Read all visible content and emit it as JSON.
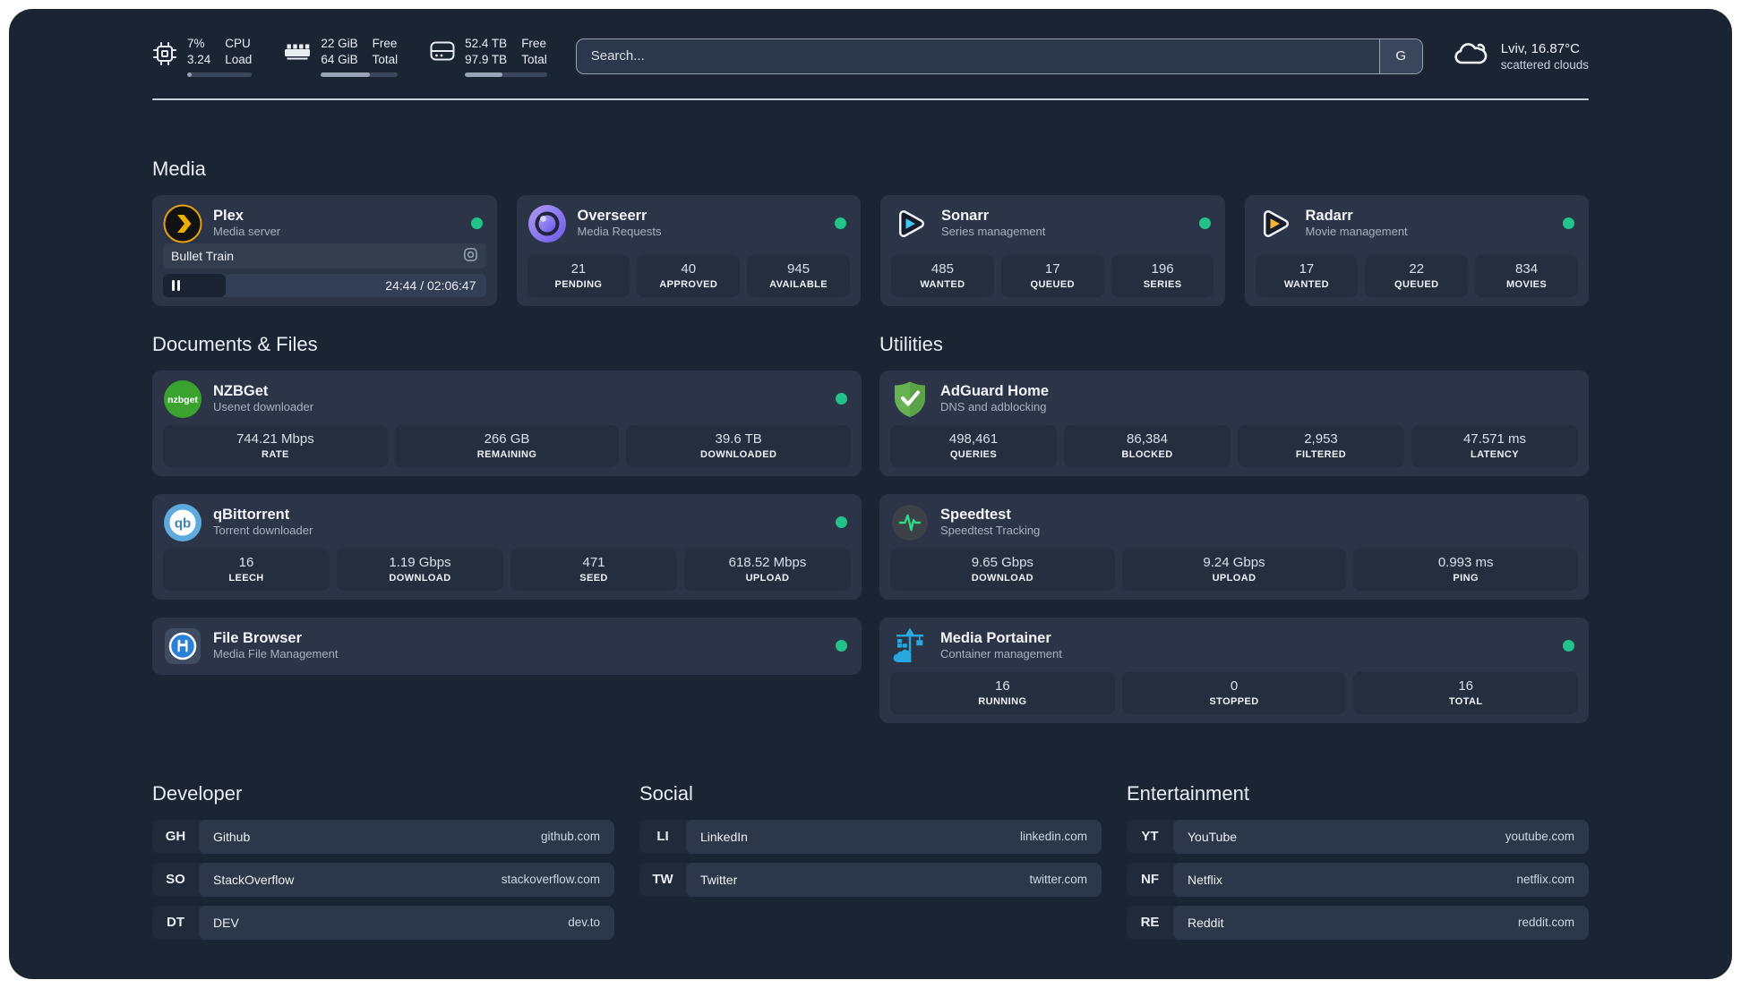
{
  "colors": {
    "accent_green": "#22c38b",
    "background": "#1b2433",
    "card": "#2b3547"
  },
  "header": {
    "monitors": [
      {
        "name": "cpu",
        "value_top": "7%",
        "value_bottom": "3.24",
        "label_top": "CPU",
        "label_bottom": "Load",
        "progress_pct": 7
      },
      {
        "name": "memory",
        "value_top": "22 GiB",
        "value_bottom": "64 GiB",
        "label_top": "Free",
        "label_bottom": "Total",
        "progress_pct": 64
      },
      {
        "name": "storage",
        "value_top": "52.4 TB",
        "value_bottom": "97.9 TB",
        "label_top": "Free",
        "label_bottom": "Total",
        "progress_pct": 46
      }
    ],
    "search": {
      "placeholder": "Search...",
      "engine_button": "G"
    },
    "weather": {
      "location": "Lviv, 16.87°C",
      "condition": "scattered clouds"
    }
  },
  "media": {
    "title": "Media",
    "plex": {
      "name": "Plex",
      "subtitle": "Media server",
      "status": "online",
      "player": {
        "title": "Bullet Train",
        "time": "24:44 / 02:06:47",
        "progress_pct": 19.5
      }
    },
    "overseerr": {
      "name": "Overseerr",
      "subtitle": "Media Requests",
      "status": "online",
      "stats": [
        {
          "value": "21",
          "label": "PENDING"
        },
        {
          "value": "40",
          "label": "APPROVED"
        },
        {
          "value": "945",
          "label": "AVAILABLE"
        }
      ]
    },
    "sonarr": {
      "name": "Sonarr",
      "subtitle": "Series management",
      "status": "online",
      "stats": [
        {
          "value": "485",
          "label": "WANTED"
        },
        {
          "value": "17",
          "label": "QUEUED"
        },
        {
          "value": "196",
          "label": "SERIES"
        }
      ]
    },
    "radarr": {
      "name": "Radarr",
      "subtitle": "Movie management",
      "status": "online",
      "stats": [
        {
          "value": "17",
          "label": "WANTED"
        },
        {
          "value": "22",
          "label": "QUEUED"
        },
        {
          "value": "834",
          "label": "MOVIES"
        }
      ]
    }
  },
  "documents": {
    "title": "Documents & Files",
    "nzbget": {
      "name": "NZBGet",
      "subtitle": "Usenet downloader",
      "status": "online",
      "stats": [
        {
          "value": "744.21 Mbps",
          "label": "RATE"
        },
        {
          "value": "266 GB",
          "label": "REMAINING"
        },
        {
          "value": "39.6 TB",
          "label": "DOWNLOADED"
        }
      ]
    },
    "qbittorrent": {
      "name": "qBittorrent",
      "subtitle": "Torrent downloader",
      "status": "online",
      "stats": [
        {
          "value": "16",
          "label": "LEECH"
        },
        {
          "value": "1.19 Gbps",
          "label": "DOWNLOAD"
        },
        {
          "value": "471",
          "label": "SEED"
        },
        {
          "value": "618.52 Mbps",
          "label": "UPLOAD"
        }
      ]
    },
    "filebrowser": {
      "name": "File Browser",
      "subtitle": "Media File Management",
      "status": "online"
    }
  },
  "utilities": {
    "title": "Utilities",
    "adguard": {
      "name": "AdGuard Home",
      "subtitle": "DNS and adblocking",
      "stats": [
        {
          "value": "498,461",
          "label": "QUERIES"
        },
        {
          "value": "86,384",
          "label": "BLOCKED"
        },
        {
          "value": "2,953",
          "label": "FILTERED"
        },
        {
          "value": "47.571 ms",
          "label": "LATENCY"
        }
      ]
    },
    "speedtest": {
      "name": "Speedtest",
      "subtitle": "Speedtest Tracking",
      "stats": [
        {
          "value": "9.65 Gbps",
          "label": "DOWNLOAD"
        },
        {
          "value": "9.24 Gbps",
          "label": "UPLOAD"
        },
        {
          "value": "0.993 ms",
          "label": "PING"
        }
      ]
    },
    "portainer": {
      "name": "Media Portainer",
      "subtitle": "Container management",
      "status": "online",
      "stats": [
        {
          "value": "16",
          "label": "RUNNING"
        },
        {
          "value": "0",
          "label": "STOPPED"
        },
        {
          "value": "16",
          "label": "TOTAL"
        }
      ]
    }
  },
  "bookmarks": {
    "developer": {
      "title": "Developer",
      "links": [
        {
          "abbr": "GH",
          "name": "Github",
          "url": "github.com"
        },
        {
          "abbr": "SO",
          "name": "StackOverflow",
          "url": "stackoverflow.com"
        },
        {
          "abbr": "DT",
          "name": "DEV",
          "url": "dev.to"
        }
      ]
    },
    "social": {
      "title": "Social",
      "links": [
        {
          "abbr": "LI",
          "name": "LinkedIn",
          "url": "linkedin.com"
        },
        {
          "abbr": "TW",
          "name": "Twitter",
          "url": "twitter.com"
        }
      ]
    },
    "entertainment": {
      "title": "Entertainment",
      "links": [
        {
          "abbr": "YT",
          "name": "YouTube",
          "url": "youtube.com"
        },
        {
          "abbr": "NF",
          "name": "Netflix",
          "url": "netflix.com"
        },
        {
          "abbr": "RE",
          "name": "Reddit",
          "url": "reddit.com"
        }
      ]
    }
  }
}
